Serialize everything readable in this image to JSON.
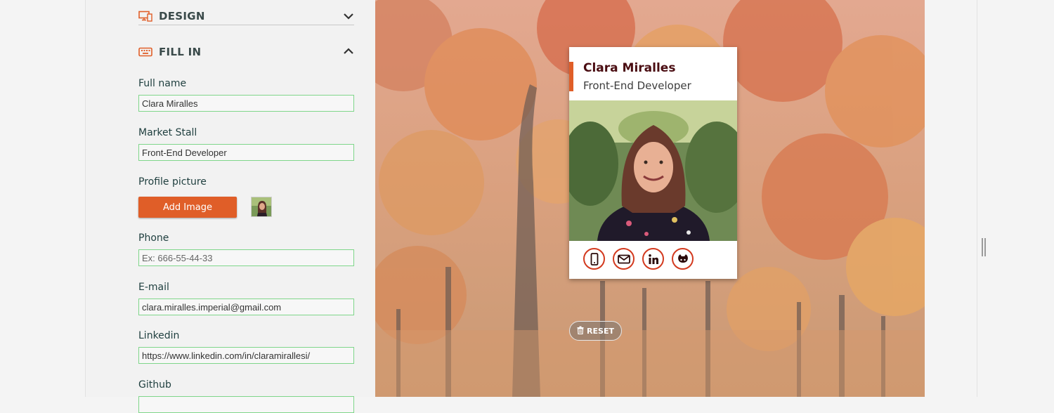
{
  "sections": {
    "design": {
      "title": "DESIGN",
      "icon": "monitor-brush-icon",
      "expanded": false
    },
    "fill_in": {
      "title": "FILL IN",
      "icon": "keyboard-icon",
      "expanded": true
    }
  },
  "form": {
    "full_name": {
      "label": "Full name",
      "value": "Clara Miralles",
      "placeholder": ""
    },
    "market_stall": {
      "label": "Market Stall",
      "value": "Front-End Developer",
      "placeholder": ""
    },
    "profile_picture": {
      "label": "Profile picture",
      "button": "Add Image"
    },
    "phone": {
      "label": "Phone",
      "value": "",
      "placeholder": "Ex: 666-55-44-33"
    },
    "email": {
      "label": "E-mail",
      "value": "clara.miralles.imperial@gmail.com",
      "placeholder": ""
    },
    "linkedin": {
      "label": "Linkedin",
      "value": "https://www.linkedin.com/in/claramirallesi/",
      "placeholder": ""
    },
    "github": {
      "label": "Github"
    }
  },
  "card": {
    "name": "Clara Miralles",
    "job": "Front-End Developer",
    "social_icons": [
      "mobile-icon",
      "envelope-icon",
      "linkedin-icon",
      "github-icon"
    ],
    "accent_color": "#e05e28",
    "name_color": "#4a0d12",
    "icon_color": "#d33a1f"
  },
  "reset": {
    "label": "RESET",
    "icon": "trash-icon"
  },
  "colors": {
    "input_border": "#7fd68a",
    "button": "#e05e28",
    "panel_bg": "#f2f2f2"
  }
}
